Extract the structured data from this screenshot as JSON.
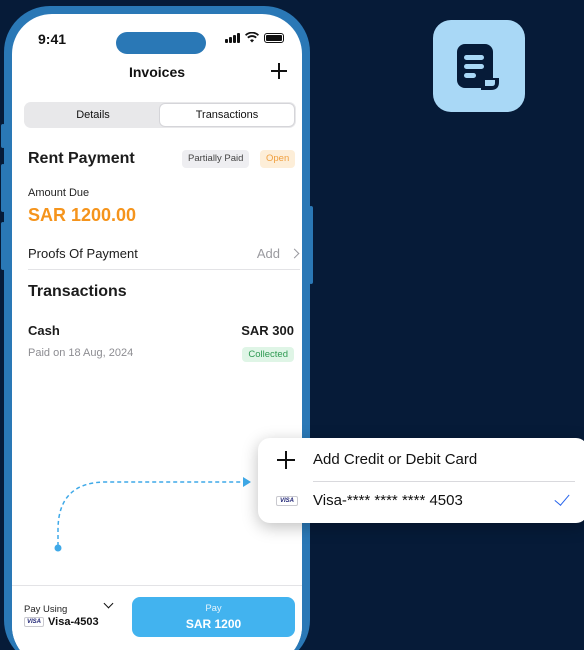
{
  "status_bar": {
    "time": "9:41"
  },
  "header": {
    "title": "Invoices"
  },
  "tabs": [
    {
      "label": "Details",
      "active": false
    },
    {
      "label": "Transactions",
      "active": true
    }
  ],
  "invoice": {
    "title": "Rent Payment",
    "badges": [
      "Partially Paid",
      "Open"
    ],
    "amount_label": "Amount Due",
    "amount_value": "SAR 1200.00"
  },
  "proofs": {
    "label": "Proofs Of Payment",
    "action": "Add"
  },
  "transactions": {
    "heading": "Transactions",
    "items": [
      {
        "method": "Cash",
        "amount": "SAR 300",
        "date": "Paid on 18 Aug, 2024",
        "status": "Collected"
      }
    ]
  },
  "payment": {
    "pay_using_label": "Pay Using",
    "card_brand": "VISA",
    "card_label": "Visa-4503",
    "pay_button_label": "Pay",
    "pay_button_amount": "SAR 1200"
  },
  "card_picker": {
    "add_label": "Add Credit or Debit Card",
    "card_brand": "VISA",
    "card_label": "Visa-**** **** **** 4503"
  },
  "colors": {
    "background": "#061b38",
    "phone_frame": "#2a78b6",
    "accent_amount": "#f5941c",
    "pay_button": "#42b3ef",
    "app_icon": "#a9d8f6",
    "collected_green": "#2f9a53",
    "check_blue": "#2563eb"
  },
  "icons": {
    "app": "invoice-receipt-icon",
    "add": "plus-icon",
    "selected": "checkmark-icon",
    "chevron": "chevron-right-icon"
  }
}
